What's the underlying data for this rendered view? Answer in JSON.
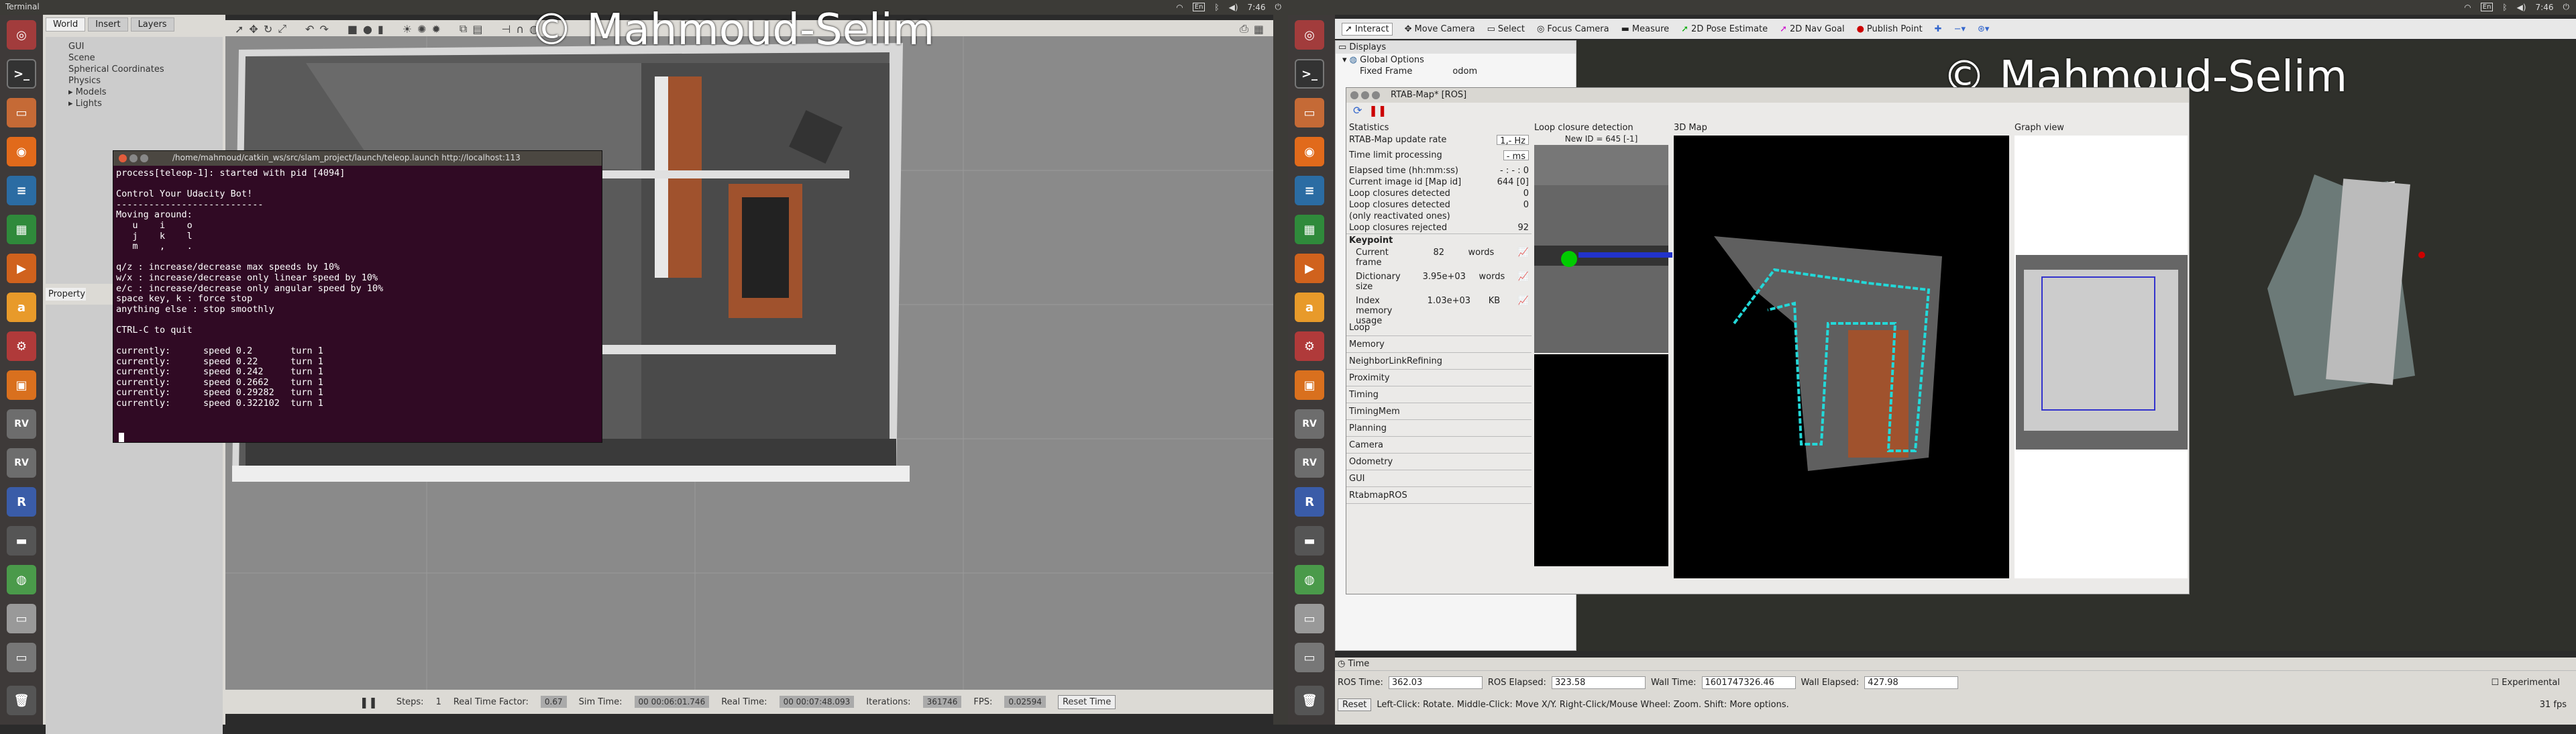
{
  "left": {
    "app_title": "Terminal",
    "time": "7:46",
    "lang": "En"
  },
  "right": {
    "time": "7:46",
    "lang": "En"
  },
  "watermark": "© Mahmoud-Selim",
  "gazebo": {
    "tabs": [
      "World",
      "Insert",
      "Layers"
    ],
    "tree": [
      "GUI",
      "Scene",
      "Spherical Coordinates",
      "Physics",
      "Models",
      "Lights"
    ],
    "property_header": "Property",
    "bottom": {
      "steps_label": "Steps:",
      "steps_value": "1",
      "rtf_label": "Real Time Factor:",
      "rtf_value": "0.67",
      "sim_label": "Sim Time:",
      "sim_value": "00 00:06:01.746",
      "real_label": "Real Time:",
      "real_value": "00 00:07:48.093",
      "iter_label": "Iterations:",
      "iter_value": "361746",
      "fps_label": "FPS:",
      "fps_value": "0.02594",
      "reset": "Reset Time"
    }
  },
  "terminal": {
    "title": "/home/mahmoud/catkin_ws/src/slam_project/launch/teleop.launch http://localhost:113",
    "text": "process[teleop-1]: started with pid [4094]\n\nControl Your Udacity Bot!\n---------------------------\nMoving around:\n   u    i    o\n   j    k    l\n   m    ,    .\n\nq/z : increase/decrease max speeds by 10%\nw/x : increase/decrease only linear speed by 10%\ne/c : increase/decrease only angular speed by 10%\nspace key, k : force stop\nanything else : stop smoothly\n\nCTRL-C to quit\n\ncurrently:      speed 0.2       turn 1\ncurrently:      speed 0.22      turn 1\ncurrently:      speed 0.242     turn 1\ncurrently:      speed 0.2662    turn 1\ncurrently:      speed 0.29282   turn 1\ncurrently:      speed 0.322102  turn 1"
  },
  "rviz": {
    "tools": [
      "Interact",
      "Move Camera",
      "Select",
      "Focus Camera",
      "Measure",
      "2D Pose Estimate",
      "2D Nav Goal",
      "Publish Point"
    ],
    "displays_title": "Displays",
    "global_options": "Global Options",
    "fixed_frame_label": "Fixed Frame",
    "fixed_frame_value": "odom",
    "time_title": "Time",
    "ros_time_label": "ROS Time:",
    "ros_time": "362.03",
    "ros_elapsed_label": "ROS Elapsed:",
    "ros_elapsed": "323.58",
    "wall_time_label": "Wall Time:",
    "wall_time": "1601747326.46",
    "wall_elapsed_label": "Wall Elapsed:",
    "wall_elapsed": "427.98",
    "experimental": "Experimental",
    "reset": "Reset",
    "hint": "Left-Click: Rotate. Middle-Click: Move X/Y. Right-Click/Mouse Wheel: Zoom. Shift: More options.",
    "fps": "31 fps"
  },
  "rtabmap": {
    "title": "RTAB-Map* [ROS]",
    "panels": {
      "statistics": "Statistics",
      "loop": "Loop closure detection",
      "map3d": "3D Map",
      "graph": "Graph view"
    },
    "new_id": "New ID = 645 [-1]",
    "rows": [
      {
        "label": "RTAB-Map update rate",
        "value": "1,- Hz"
      },
      {
        "label": "Time limit processing",
        "value": "- ms"
      },
      {
        "label": "Elapsed time (hh:mm:ss)",
        "value": "- : - : 0"
      },
      {
        "label": "Current image id [Map id]",
        "value": "644 [0]"
      },
      {
        "label": "Loop closures detected",
        "value": "0"
      },
      {
        "label": "Loop closures detected",
        "value": "0"
      },
      {
        "label": "(only reactivated ones)",
        "value": ""
      },
      {
        "label": "Loop closures rejected",
        "value": "92"
      }
    ],
    "keypoint": "Keypoint",
    "kp_rows": [
      {
        "label": "Current frame",
        "value": "82",
        "unit": "words"
      },
      {
        "label": "Dictionary size",
        "value": "3.95e+03",
        "unit": "words"
      },
      {
        "label": "Index memory usage",
        "value": "1.03e+03",
        "unit": "KB"
      }
    ],
    "sections": [
      "Loop",
      "Memory",
      "NeighborLinkRefining",
      "Proximity",
      "Timing",
      "TimingMem",
      "Planning",
      "Camera",
      "Odometry",
      "GUI",
      "RtabmapROS"
    ]
  }
}
